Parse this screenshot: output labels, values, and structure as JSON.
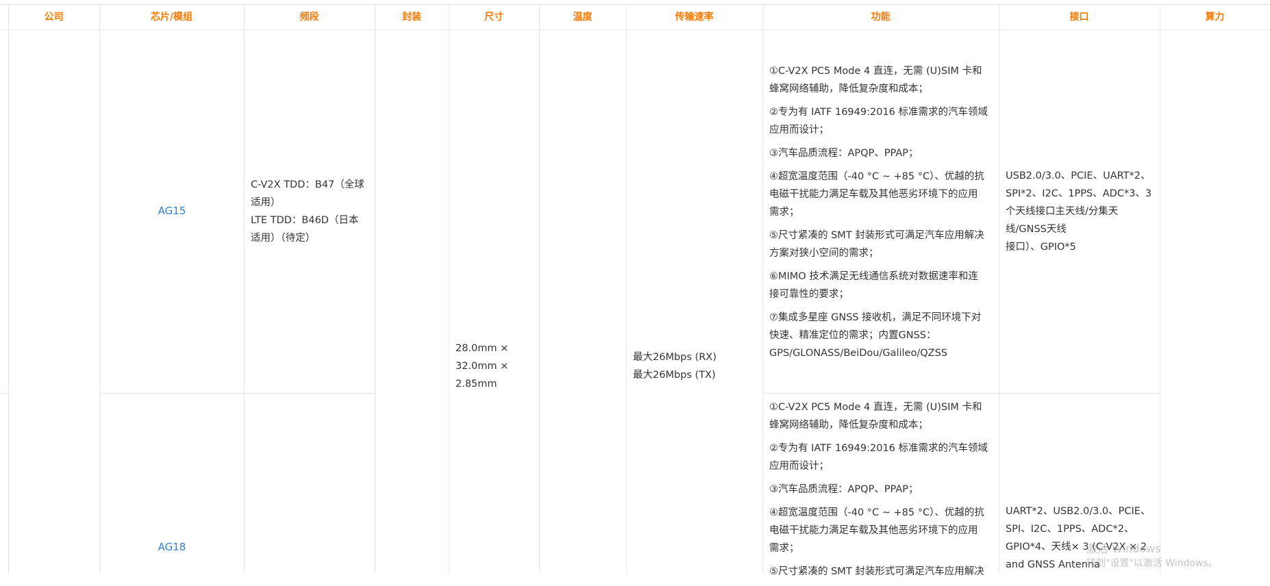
{
  "table": {
    "headers": [
      "公司",
      "芯片/模组",
      "频段",
      "封装",
      "尺寸",
      "温度",
      "传输速率",
      "功能",
      "接口",
      "算力"
    ],
    "rows": [
      {
        "chip": "AG15",
        "band_lines": [
          "C-V2X TDD：B47（全球",
          "适用）",
          "LTE TDD：B46D（日本",
          "适用）（待定）"
        ],
        "features": [
          [
            "①C-V2X PC5 Mode 4 直连，无需 (U)SIM 卡和",
            "蜂窝网络辅助，降低复杂度和成本；"
          ],
          [
            "②专为有 IATF 16949:2016 标准需求的汽车领域",
            "应用而设计；"
          ],
          [
            "③汽车品质流程：APQP、PPAP；"
          ],
          [
            "④超宽温度范围（-40 °C ~ +85 °C）、优越的抗",
            "电磁干扰能力满足车载及其他恶劣环境下的应用",
            "需求；"
          ],
          [
            "⑤尺寸紧凑的 SMT 封装形式可满足汽车应用解决",
            "方案对狭小空间的需求；"
          ],
          [
            "⑥MIMO 技术满足无线通信系统对数据速率和连",
            "接可靠性的要求；"
          ],
          [
            "⑦集成多星座 GNSS 接收机，满足不同环境下对",
            "快速、精准定位的需求；内置GNSS：",
            "GPS/GLONASS/BeiDou/Galileo/QZSS"
          ]
        ],
        "interface_lines": [
          "USB2.0/3.0、PCIE、UART*2、",
          "SPI*2、I2C、1PPS、ADC*3、3",
          "个天线接口主天线/分集天",
          "线/GNSS天线",
          "接口）、GPIO*5"
        ]
      },
      {
        "chip": "AG18",
        "features": [
          [
            "①C-V2X PC5 Mode 4 直连，无需 (U)SIM 卡和",
            "蜂窝网络辅助，降低复杂度和成本；"
          ],
          [
            "②专为有 IATF 16949:2016 标准需求的汽车领域",
            "应用而设计；"
          ],
          [
            "③汽车品质流程：APQP、PPAP；"
          ],
          [
            "④超宽温度范围（-40 °C ~ +85 °C）、优越的抗",
            "电磁干扰能力满足车载及其他恶劣环境下的应用",
            "需求；"
          ],
          [
            "⑤尺寸紧凑的 SMT 封装形式可满足汽车应用解决"
          ]
        ],
        "interface_lines": [
          "UART*2、USB2.0/3.0、PCIE、",
          "SPI、I2C、1PPS、ADC*2、",
          "GPIO*4、天线× 3 (C-V2X × 2",
          "and GNSS Antenna"
        ]
      }
    ],
    "shared": {
      "size_lines": [
        "28.0mm ×",
        "32.0mm ×",
        "2.85mm"
      ],
      "rate_lines": [
        "最大26Mbps (RX)",
        "最大26Mbps (TX)"
      ]
    }
  },
  "watermark": {
    "line1": "激活 Windows",
    "line2": "转到\"设置\"以激活 Windows。"
  },
  "colors": {
    "header_text": "#ff7a00",
    "link": "#2f7fd1",
    "border": "#e8e8e8"
  }
}
